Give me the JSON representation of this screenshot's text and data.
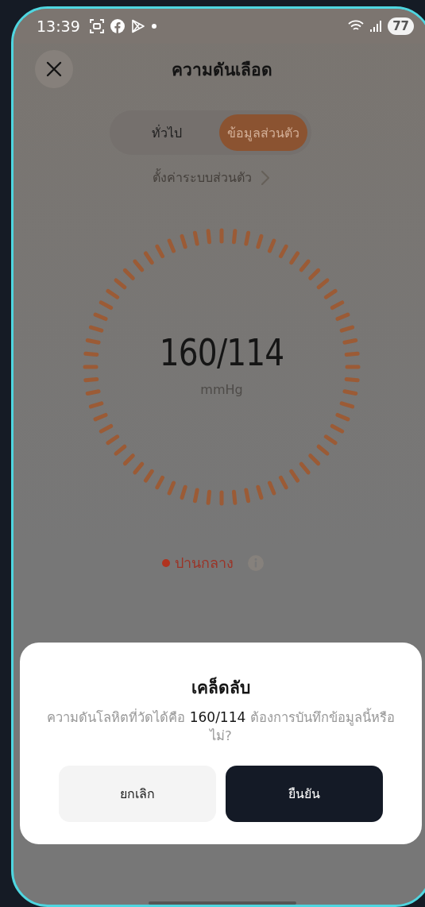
{
  "status_bar": {
    "time": "13:39",
    "battery": "77"
  },
  "header": {
    "title": "ความดันเลือด"
  },
  "tabs": [
    {
      "label": "ทั่วไป",
      "selected": false
    },
    {
      "label": "ข้อมูลส่วนตัว",
      "selected": true
    }
  ],
  "settings_link": "ตั้งค่าระบบส่วนตัว",
  "reading": {
    "value": "160/114",
    "unit": "mmHg",
    "status": "ปานกลาง"
  },
  "dialog": {
    "title": "เคล็ดลับ",
    "message": "ความดันโลหิตที่วัดได้คือ **160/114** ต้องการบันทึกข้อมูลนี้หรือไม่?",
    "buttons": [
      {
        "label": "ยกเลิก",
        "kind": "secondary"
      },
      {
        "label": "ยืนยัน",
        "kind": "primary"
      }
    ]
  }
}
